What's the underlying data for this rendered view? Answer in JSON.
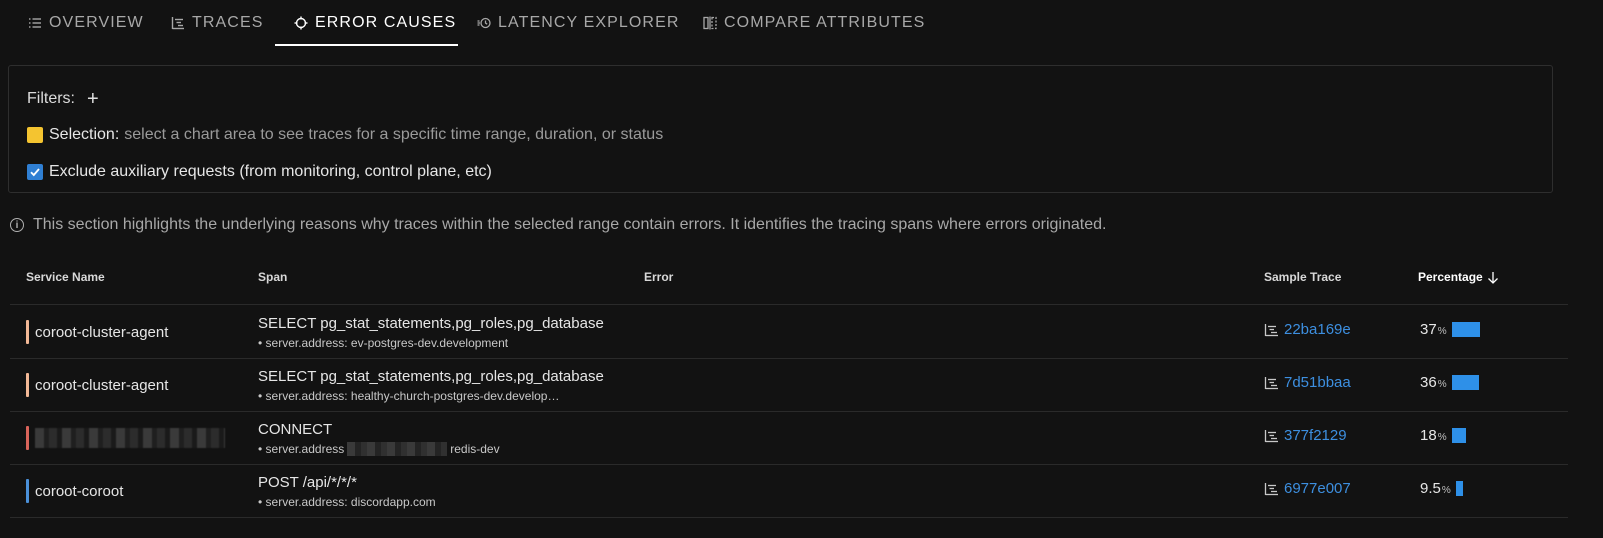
{
  "tabs": [
    {
      "label": "OVERVIEW",
      "icon": "list-icon"
    },
    {
      "label": "TRACES",
      "icon": "traces-icon"
    },
    {
      "label": "ERROR CAUSES",
      "icon": "crosshair-icon",
      "active": true
    },
    {
      "label": "LATENCY EXPLORER",
      "icon": "latency-icon"
    },
    {
      "label": "COMPARE ATTRIBUTES",
      "icon": "compare-icon"
    }
  ],
  "filters": {
    "label": "Filters:",
    "add": "+",
    "selection_label": "Selection:",
    "selection_text": "select a chart area to see traces for a specific time range, duration, or status",
    "exclude_label": "Exclude auxiliary requests (from monitoring, control plane, etc)",
    "exclude_checked": true
  },
  "info": "This section highlights the underlying reasons why traces within the selected range contain errors. It identifies the tracing spans where errors originated.",
  "table": {
    "headers": {
      "service": "Service Name",
      "span": "Span",
      "error": "Error",
      "sample": "Sample Trace",
      "percentage": "Percentage"
    },
    "rows": [
      {
        "service": "coroot-cluster-agent",
        "color": "#f2b896",
        "span": "SELECT pg_stat_statements,pg_roles,pg_database",
        "attr": "• server.address: ev-postgres-dev.development",
        "trace": "22ba169e",
        "pct": "37",
        "pct_value": 37
      },
      {
        "service": "coroot-cluster-agent",
        "color": "#f2b896",
        "span": "SELECT pg_stat_statements,pg_roles,pg_database",
        "attr": "• server.address: healthy-church-postgres-dev.develop…",
        "trace": "7d51bbaa",
        "pct": "36",
        "pct_value": 36
      },
      {
        "service": "",
        "color": "#d9645a",
        "span": "CONNECT",
        "attr_prefix": "• server.address",
        "attr_suffix": "redis-dev",
        "trace": "377f2129",
        "pct": "18",
        "pct_value": 18
      },
      {
        "service": "coroot-coroot",
        "color": "#4a90d9",
        "span": "POST /api/*/*/*",
        "attr": "• server.address: discordapp.com",
        "trace": "6977e007",
        "pct": "9.5",
        "pct_value": 9.5
      }
    ]
  }
}
